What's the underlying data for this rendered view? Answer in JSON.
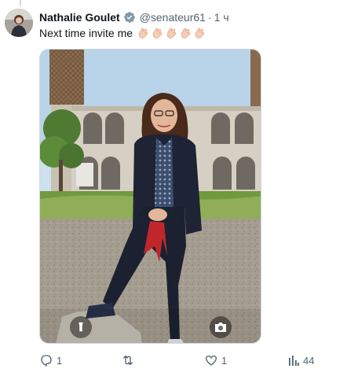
{
  "tweet": {
    "author": {
      "name": "Nathalie Goulet",
      "handle": "@senateur61",
      "separator": "·",
      "time": "1 ч"
    },
    "text": "Next time invite me",
    "emojis": [
      "clapping-hands-icon",
      "clapping-hands-icon",
      "clapping-hands-icon",
      "clapping-hands-icon",
      "clapping-hands-icon"
    ],
    "media": {
      "type": "photo",
      "badges": [
        "flashlight-icon",
        "camera-icon"
      ]
    }
  },
  "actions": {
    "replies": "1",
    "reposts": "",
    "likes": "1",
    "views": "44"
  },
  "colors": {
    "text": "#0f1419",
    "secondary": "#536471",
    "verified": "#829aab",
    "border": "#cfd9de"
  }
}
